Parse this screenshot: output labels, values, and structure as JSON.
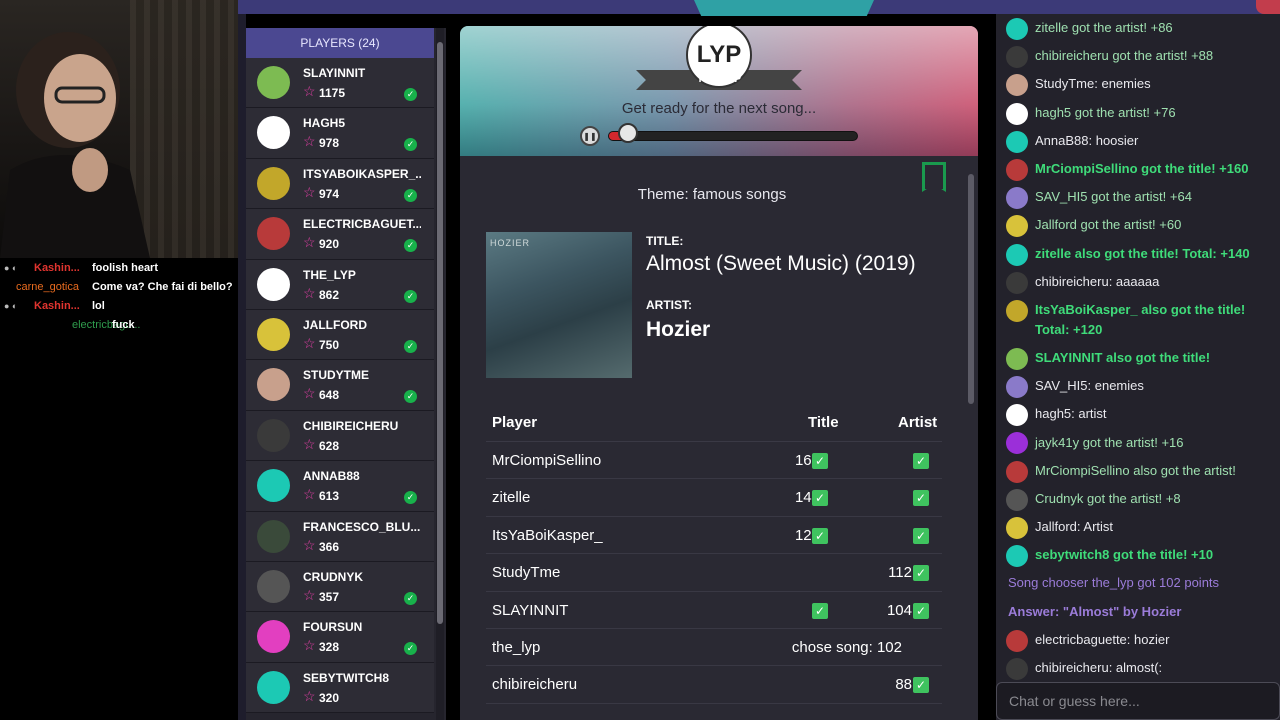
{
  "stream_chat": [
    {
      "user": "Kashin...",
      "msg": "foolish heart",
      "style": "red"
    },
    {
      "user": "carne_gotica",
      "msg": "Come va? Che fai di bello?",
      "style": "orange"
    },
    {
      "user": "Kashin...",
      "msg": "lol",
      "style": "red"
    },
    {
      "user": "electricbagu...",
      "msg": "fuck",
      "style": "green"
    }
  ],
  "players": {
    "header": "PLAYERS (24)",
    "list": [
      {
        "name": "SLAYINNIT",
        "points": "1175",
        "guessed": true,
        "avatar_color": "#7dbb52"
      },
      {
        "name": "HAGH5",
        "points": "978",
        "guessed": true,
        "avatar_color": "#ffffff"
      },
      {
        "name": "ITSYABOIKASPER_...",
        "points": "974",
        "guessed": true,
        "avatar_color": "#c2a72a"
      },
      {
        "name": "ELECTRICBAGUET...",
        "points": "920",
        "guessed": true,
        "avatar_color": "#b83a3a"
      },
      {
        "name": "THE_LYP",
        "points": "862",
        "guessed": true,
        "avatar_color": "#ffffff"
      },
      {
        "name": "JALLFORD",
        "points": "750",
        "guessed": true,
        "avatar_color": "#d8c23a"
      },
      {
        "name": "STUDYTME",
        "points": "648",
        "guessed": true,
        "avatar_color": "#c8a08c"
      },
      {
        "name": "CHIBIREICHERU",
        "points": "628",
        "guessed": false,
        "avatar_color": "#3a3a3a"
      },
      {
        "name": "ANNAB88",
        "points": "613",
        "guessed": true,
        "avatar_color": "#1cc9b4"
      },
      {
        "name": "FRANCESCO_BLU...",
        "points": "366",
        "guessed": false,
        "avatar_color": "#3a4a3a"
      },
      {
        "name": "CRUDNYK",
        "points": "357",
        "guessed": true,
        "avatar_color": "#555555"
      },
      {
        "name": "FOURSUN",
        "points": "328",
        "guessed": true,
        "avatar_color": "#e23fc0"
      },
      {
        "name": "SEBYTWITCH8",
        "points": "320",
        "guessed": false,
        "avatar_color": "#1cc9b4"
      }
    ]
  },
  "game": {
    "host_logo": "LYP",
    "host_name": "THE_LYP",
    "status": "Get ready for the next song...",
    "progress": 0.08,
    "theme": "Theme: famous songs",
    "album_text": "HOZIER",
    "title_label": "TITLE:",
    "title": "Almost (Sweet Music) (2019)",
    "artist_label": "ARTIST:",
    "artist": "Hozier",
    "results_header": {
      "player": "Player",
      "title": "Title",
      "artist": "Artist"
    },
    "results": [
      {
        "name": "MrCiompiSellino",
        "title_score": "160",
        "title_ok": true,
        "artist_score": "",
        "artist_ok": true
      },
      {
        "name": "zitelle",
        "title_score": "140",
        "title_ok": true,
        "artist_score": "",
        "artist_ok": true
      },
      {
        "name": "ItsYaBoiKasper_",
        "title_score": "120",
        "title_ok": true,
        "artist_score": "",
        "artist_ok": true
      },
      {
        "name": "StudyTme",
        "title_score": "",
        "title_ok": false,
        "artist_score": "112",
        "artist_ok": true
      },
      {
        "name": "SLAYINNIT",
        "title_score": "",
        "title_ok": true,
        "artist_score": "104",
        "artist_ok": true
      },
      {
        "name": "the_lyp",
        "chose": "chose song: 102"
      },
      {
        "name": "chibireicheru",
        "title_score": "",
        "title_ok": false,
        "artist_score": "88",
        "artist_ok": true
      }
    ]
  },
  "chat": {
    "messages": [
      {
        "text": "zitelle got the artist! +86",
        "style": "dimgreen",
        "avatar": "#1cc9b4"
      },
      {
        "text": "chibireicheru got the artist! +88",
        "style": "dimgreen",
        "avatar": "#3a3a3a"
      },
      {
        "text": "StudyTme: enemies",
        "style": "normal",
        "avatar": "#c8a08c"
      },
      {
        "text": "hagh5 got the artist! +76",
        "style": "dimgreen",
        "avatar": "#ffffff"
      },
      {
        "text": "AnnaB88: hoosier",
        "style": "normal",
        "avatar": "#1cc9b4"
      },
      {
        "text": "MrCiompiSellino got the title! +160",
        "style": "green",
        "avatar": "#b83a3a"
      },
      {
        "text": "SAV_HI5 got the artist! +64",
        "style": "dimgreen",
        "avatar": "#8a7ac9"
      },
      {
        "text": "Jallford got the artist! +60",
        "style": "dimgreen",
        "avatar": "#d8c23a"
      },
      {
        "text": "zitelle also got the title! Total: +140",
        "style": "green",
        "avatar": "#1cc9b4"
      },
      {
        "text": "chibireicheru: aaaaaa",
        "style": "normal",
        "avatar": "#3a3a3a"
      },
      {
        "text": "ItsYaBoiKasper_ also got the title! Total: +120",
        "style": "green",
        "avatar": "#c2a72a",
        "tall": true
      },
      {
        "text": "SLAYINNIT also got the title!",
        "style": "green",
        "avatar": "#7dbb52"
      },
      {
        "text": "SAV_HI5: enemies",
        "style": "normal",
        "avatar": "#8a7ac9"
      },
      {
        "text": "hagh5: artist",
        "style": "normal",
        "avatar": "#ffffff"
      },
      {
        "text": "jayk41y got the artist! +16",
        "style": "dimgreen",
        "avatar": "#9b2fd9"
      },
      {
        "text": "MrCiompiSellino also got the artist!",
        "style": "dimgreen",
        "avatar": "#b83a3a"
      },
      {
        "text": "Crudnyk got the artist! +8",
        "style": "dimgreen",
        "avatar": "#555555"
      },
      {
        "text": "Jallford: Artist",
        "style": "normal",
        "avatar": "#d8c23a"
      },
      {
        "text": "sebytwitch8 got the title! +10",
        "style": "green",
        "avatar": "#1cc9b4"
      },
      {
        "text": "Song chooser the_lyp got 102 points",
        "style": "purple",
        "avatar": ""
      },
      {
        "text": "Answer: \"Almost\" by Hozier",
        "style": "purple-bold",
        "avatar": ""
      },
      {
        "text": "electricbaguette: hozier",
        "style": "normal",
        "avatar": "#b83a3a"
      },
      {
        "text": "chibireicheru: almost(:",
        "style": "normal",
        "avatar": "#3a3a3a"
      }
    ],
    "input_placeholder": "Chat or guess here..."
  }
}
